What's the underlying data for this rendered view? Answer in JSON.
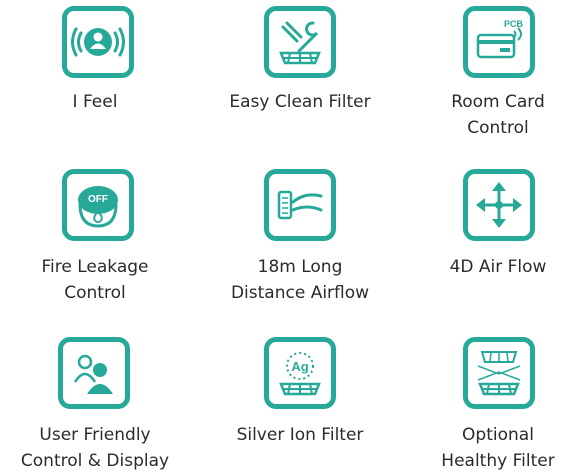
{
  "accent_color": "#27a99a",
  "features": [
    {
      "label_lines": [
        "I Feel"
      ],
      "icon": "person-signal-icon"
    },
    {
      "label_lines": [
        "Easy Clean Filter"
      ],
      "icon": "filter-tools-icon"
    },
    {
      "label_lines": [
        "Room Card",
        "Control"
      ],
      "icon": "room-card-icon",
      "icon_text": "PCB"
    },
    {
      "label_lines": [
        "Fire Leakage",
        "Control"
      ],
      "icon": "fire-off-icon",
      "icon_text": "OFF"
    },
    {
      "label_lines": [
        "18m Long",
        "Distance Airflow"
      ],
      "icon": "long-airflow-icon"
    },
    {
      "label_lines": [
        "4D Air Flow"
      ],
      "icon": "four-way-arrows-icon"
    },
    {
      "label_lines": [
        "User Friendly",
        "Control & Display"
      ],
      "icon": "users-icon"
    },
    {
      "label_lines": [
        "Silver Ion Filter"
      ],
      "icon": "silver-ion-icon",
      "icon_text": "Ag"
    },
    {
      "label_lines": [
        "Optional",
        "Healthy Filter"
      ],
      "icon": "healthy-filter-icon"
    }
  ]
}
